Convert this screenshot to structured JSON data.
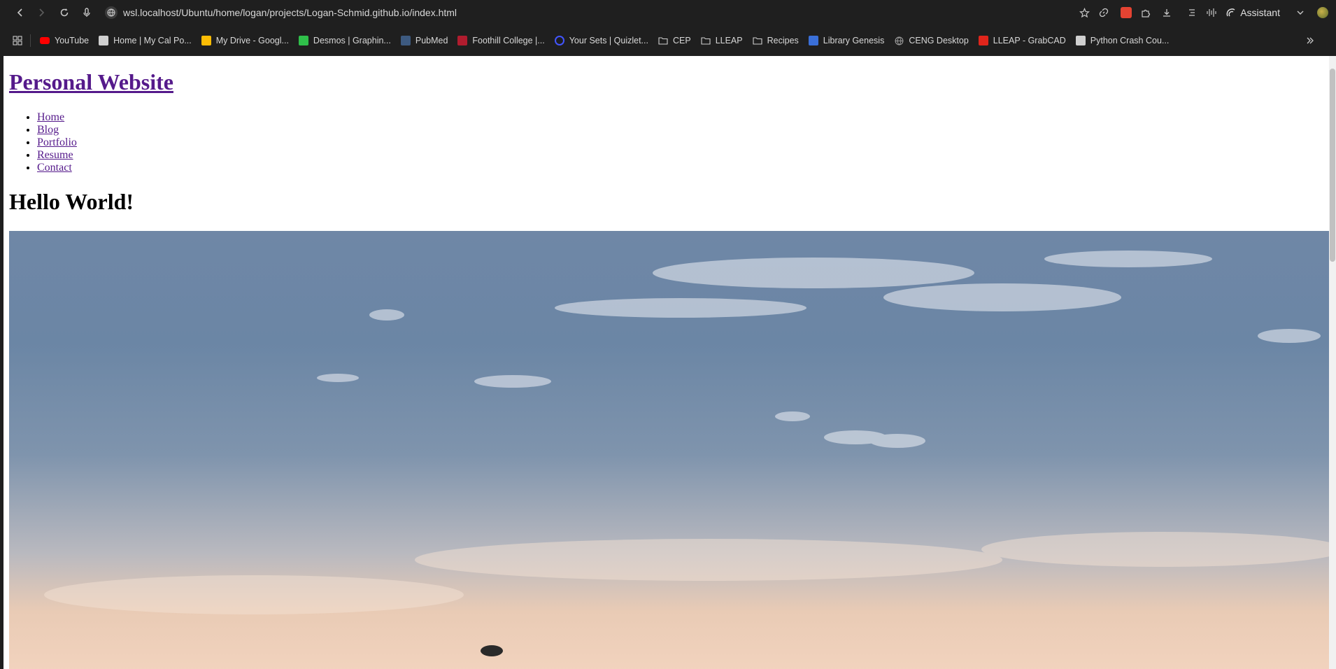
{
  "browser": {
    "url": "wsl.localhost/Ubuntu/home/logan/projects/Logan-Schmid.github.io/index.html",
    "assistant_label": "Assistant"
  },
  "bookmarks": [
    {
      "label": "YouTube",
      "icon": "youtube-icon",
      "color": "#ff0000"
    },
    {
      "label": "Home | My Cal Po...",
      "icon": "shield-icon",
      "color": "#cfcfcf"
    },
    {
      "label": "My Drive - Googl...",
      "icon": "drive-icon",
      "color": "#fbbc04"
    },
    {
      "label": "Desmos | Graphin...",
      "icon": "desmos-icon",
      "color": "#2fbf4a"
    },
    {
      "label": "PubMed",
      "icon": "pubmed-icon",
      "color": "#3d5a80"
    },
    {
      "label": "Foothill College |...",
      "icon": "foothill-icon",
      "color": "#b01c2e"
    },
    {
      "label": "Your Sets | Quizlet...",
      "icon": "quizlet-icon",
      "color": "#4255ff"
    },
    {
      "label": "CEP",
      "icon": "folder-icon",
      "color": "#cfcfcf"
    },
    {
      "label": "LLEAP",
      "icon": "folder-icon",
      "color": "#cfcfcf"
    },
    {
      "label": "Recipes",
      "icon": "folder-icon",
      "color": "#cfcfcf"
    },
    {
      "label": "Library Genesis",
      "icon": "book-icon",
      "color": "#3a6fd8"
    },
    {
      "label": "CENG Desktop",
      "icon": "globe-icon",
      "color": "#9e9e9e"
    },
    {
      "label": "LLEAP - GrabCAD",
      "icon": "grabcad-icon",
      "color": "#e0251b"
    },
    {
      "label": "Python Crash Cou...",
      "icon": "python-icon",
      "color": "#cfcfcf"
    }
  ],
  "page": {
    "site_title": "Personal Website",
    "nav": [
      "Home",
      "Blog",
      "Portfolio",
      "Resume",
      "Contact"
    ],
    "heading": "Hello World!"
  },
  "colors": {
    "link_visited": "#551a8b",
    "chrome_bg": "#1f1f1f"
  }
}
